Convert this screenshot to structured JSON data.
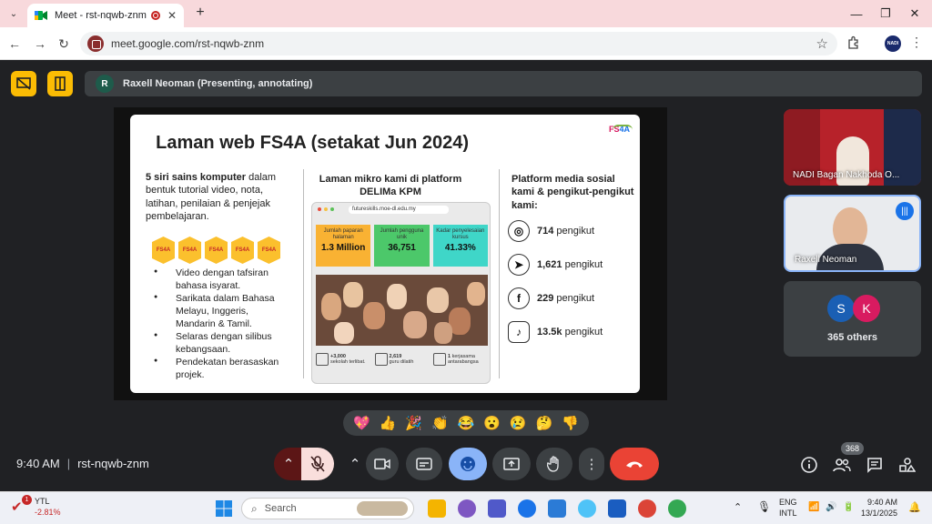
{
  "browser": {
    "tab_title": "Meet - rst-nqwb-znm",
    "url": "meet.google.com/rst-nqwb-znm",
    "profile_label": "NADI"
  },
  "presenter": {
    "avatar": "R",
    "name": "Raxell Neoman (Presenting, annotating)"
  },
  "slide": {
    "title": "Laman web FS4A (setakat Jun 2024)",
    "logo_a": "FS",
    "logo_b": "4A",
    "col1": {
      "head_bold": "5 siri sains komputer",
      "head_rest": " dalam bentuk tutorial video, nota, latihan, penilaian & penjejak pembelajaran.",
      "badges": [
        "FS4A",
        "FS4A",
        "FS4A",
        "FS4A",
        "FS4A"
      ],
      "bullets": [
        "Video dengan tafsiran bahasa isyarat.",
        "Sarikata dalam Bahasa Melayu, Inggeris, Mandarin & Tamil.",
        "Selaras dengan silibus kebangsaan.",
        "Pendekatan berasaskan projek."
      ]
    },
    "col2": {
      "head": "Laman mikro kami di platform DELIMa KPM",
      "url": "futureskills.moe-dl.edu.my",
      "stats": [
        {
          "label": "Jumlah paparan halaman",
          "value": "1.3 Million",
          "color": "#f9b233"
        },
        {
          "label": "Jumlah pengguna unik",
          "value": "36,751",
          "color": "#4cc86a"
        },
        {
          "label": "Kadar penyelesaian kursus",
          "value": "41.33%",
          "color": "#3fd6c8"
        }
      ],
      "footer": [
        {
          "value": "+3,000",
          "label": "sekolah terlibat."
        },
        {
          "value": "2,619",
          "label": "guru dilatih"
        },
        {
          "value": "1",
          "label": "kerjasama antarabangsa"
        }
      ]
    },
    "col3": {
      "head": "Platform media sosial kami & pengikut-pengikut kami:",
      "socials": [
        {
          "icon": "instagram-icon",
          "glyph": "◎",
          "count": "714",
          "suffix": " pengikut"
        },
        {
          "icon": "telegram-icon",
          "glyph": "➤",
          "count": "1,621",
          "suffix": " pengikut"
        },
        {
          "icon": "facebook-icon",
          "glyph": "f",
          "count": "229",
          "suffix": " pengikut"
        },
        {
          "icon": "tiktok-icon",
          "glyph": "♪",
          "count": "13.5k",
          "suffix": " pengikut"
        }
      ]
    }
  },
  "tiles": {
    "tile1_name": "NADI Bagan Nakhoda O...",
    "tile2_name": "Raxell Neoman",
    "tile3_avatars": [
      "S",
      "K"
    ],
    "tile3_others": "365 others"
  },
  "reactions": [
    "💖",
    "👍",
    "🎉",
    "👏",
    "😂",
    "😮",
    "😢",
    "🤔",
    "👎"
  ],
  "meeting": {
    "time": "9:40 AM",
    "separator": "|",
    "code": "rst-nqwb-znm",
    "participants_count": "368"
  },
  "taskbar": {
    "ticker": "YTL",
    "ticker_change": "-2.81%",
    "ticker_badge": "1",
    "search_placeholder": "Search",
    "lang_1": "ENG",
    "lang_2": "INTL",
    "clock_time": "9:40 AM",
    "clock_date": "13/1/2025"
  },
  "colors": {
    "accent": "#fbbc04",
    "leave": "#ea4335",
    "mic_off": "#f9dedc",
    "emoji_active": "#8ab4f8"
  }
}
